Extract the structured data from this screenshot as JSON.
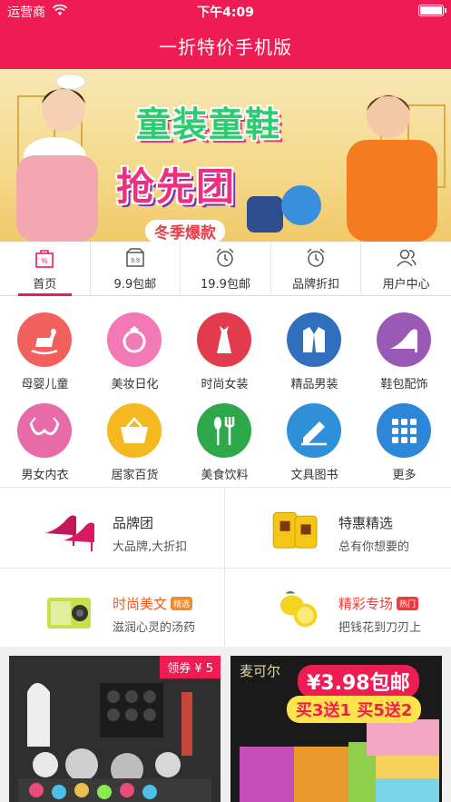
{
  "status_bar": {
    "carrier": "运营商",
    "time": "下午4:09"
  },
  "app": {
    "title": "一折特价手机版"
  },
  "banner": {
    "line1": "童装童鞋",
    "line2": "抢先团",
    "line3": "冬季爆款"
  },
  "tabs": [
    {
      "label": "首页",
      "icon": "bag-icon",
      "active": true
    },
    {
      "label": "9.9包邮",
      "icon": "box-9-9-icon",
      "active": false
    },
    {
      "label": "19.9包邮",
      "icon": "alarm-clock-icon",
      "active": false
    },
    {
      "label": "品牌折扣",
      "icon": "alarm-clock-icon",
      "active": false
    },
    {
      "label": "用户中心",
      "icon": "users-icon",
      "active": false
    }
  ],
  "categories": [
    {
      "label": "母婴儿童",
      "icon": "rocking-horse-icon",
      "color": "#f25f5c"
    },
    {
      "label": "美妆日化",
      "icon": "ring-icon",
      "color": "#f279b6"
    },
    {
      "label": "时尚女装",
      "icon": "dress-icon",
      "color": "#e23b4e"
    },
    {
      "label": "精品男装",
      "icon": "suit-icon",
      "color": "#2f6fbe"
    },
    {
      "label": "鞋包配饰",
      "icon": "high-heel-icon",
      "color": "#9b59b6"
    },
    {
      "label": "男女内衣",
      "icon": "bra-icon",
      "color": "#e86aa8"
    },
    {
      "label": "居家百货",
      "icon": "basket-icon",
      "color": "#f5b81f"
    },
    {
      "label": "美食饮料",
      "icon": "utensils-icon",
      "color": "#2ea84a"
    },
    {
      "label": "文具图书",
      "icon": "pencil-icon",
      "color": "#2e90d8"
    },
    {
      "label": "更多",
      "icon": "grid-icon",
      "color": "#2e86d8"
    }
  ],
  "promos": [
    {
      "title": "品牌团",
      "subtitle": "大品牌,大折扣",
      "tag": "",
      "icon": "high-heels-image"
    },
    {
      "title": "特惠精选",
      "subtitle": "总有你想要的",
      "tag": "",
      "icon": "suitcase-image"
    },
    {
      "title": "时尚美文",
      "subtitle": "滋润心灵的汤药",
      "tag": "精选",
      "icon": "camera-image"
    },
    {
      "title": "精彩专场",
      "subtitle": "把钱花到刀刃上",
      "tag": "热门",
      "icon": "lemon-image"
    }
  ],
  "products": [
    {
      "coupon": "领券 ¥ 5"
    },
    {
      "brand": "麦可尔",
      "price": "¥3.98包邮",
      "deal": "买3送1 买5送2"
    }
  ]
}
